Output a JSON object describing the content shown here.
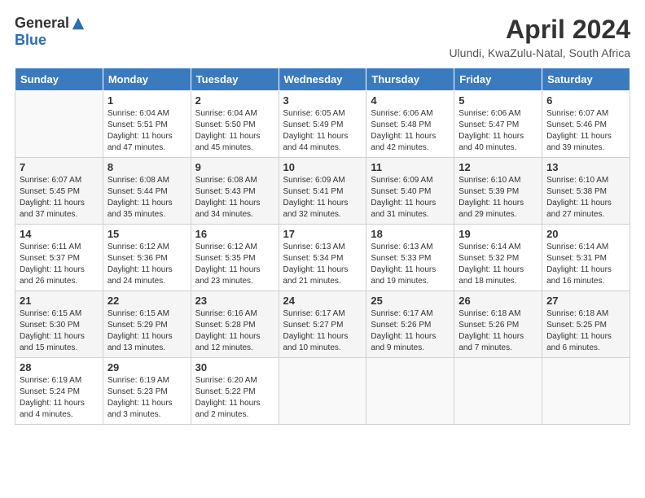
{
  "header": {
    "logo_general": "General",
    "logo_blue": "Blue",
    "main_title": "April 2024",
    "subtitle": "Ulundi, KwaZulu-Natal, South Africa"
  },
  "calendar": {
    "days_of_week": [
      "Sunday",
      "Monday",
      "Tuesday",
      "Wednesday",
      "Thursday",
      "Friday",
      "Saturday"
    ],
    "weeks": [
      [
        {
          "day": "",
          "info": ""
        },
        {
          "day": "1",
          "info": "Sunrise: 6:04 AM\nSunset: 5:51 PM\nDaylight: 11 hours\nand 47 minutes."
        },
        {
          "day": "2",
          "info": "Sunrise: 6:04 AM\nSunset: 5:50 PM\nDaylight: 11 hours\nand 45 minutes."
        },
        {
          "day": "3",
          "info": "Sunrise: 6:05 AM\nSunset: 5:49 PM\nDaylight: 11 hours\nand 44 minutes."
        },
        {
          "day": "4",
          "info": "Sunrise: 6:06 AM\nSunset: 5:48 PM\nDaylight: 11 hours\nand 42 minutes."
        },
        {
          "day": "5",
          "info": "Sunrise: 6:06 AM\nSunset: 5:47 PM\nDaylight: 11 hours\nand 40 minutes."
        },
        {
          "day": "6",
          "info": "Sunrise: 6:07 AM\nSunset: 5:46 PM\nDaylight: 11 hours\nand 39 minutes."
        }
      ],
      [
        {
          "day": "7",
          "info": "Sunrise: 6:07 AM\nSunset: 5:45 PM\nDaylight: 11 hours\nand 37 minutes."
        },
        {
          "day": "8",
          "info": "Sunrise: 6:08 AM\nSunset: 5:44 PM\nDaylight: 11 hours\nand 35 minutes."
        },
        {
          "day": "9",
          "info": "Sunrise: 6:08 AM\nSunset: 5:43 PM\nDaylight: 11 hours\nand 34 minutes."
        },
        {
          "day": "10",
          "info": "Sunrise: 6:09 AM\nSunset: 5:41 PM\nDaylight: 11 hours\nand 32 minutes."
        },
        {
          "day": "11",
          "info": "Sunrise: 6:09 AM\nSunset: 5:40 PM\nDaylight: 11 hours\nand 31 minutes."
        },
        {
          "day": "12",
          "info": "Sunrise: 6:10 AM\nSunset: 5:39 PM\nDaylight: 11 hours\nand 29 minutes."
        },
        {
          "day": "13",
          "info": "Sunrise: 6:10 AM\nSunset: 5:38 PM\nDaylight: 11 hours\nand 27 minutes."
        }
      ],
      [
        {
          "day": "14",
          "info": "Sunrise: 6:11 AM\nSunset: 5:37 PM\nDaylight: 11 hours\nand 26 minutes."
        },
        {
          "day": "15",
          "info": "Sunrise: 6:12 AM\nSunset: 5:36 PM\nDaylight: 11 hours\nand 24 minutes."
        },
        {
          "day": "16",
          "info": "Sunrise: 6:12 AM\nSunset: 5:35 PM\nDaylight: 11 hours\nand 23 minutes."
        },
        {
          "day": "17",
          "info": "Sunrise: 6:13 AM\nSunset: 5:34 PM\nDaylight: 11 hours\nand 21 minutes."
        },
        {
          "day": "18",
          "info": "Sunrise: 6:13 AM\nSunset: 5:33 PM\nDaylight: 11 hours\nand 19 minutes."
        },
        {
          "day": "19",
          "info": "Sunrise: 6:14 AM\nSunset: 5:32 PM\nDaylight: 11 hours\nand 18 minutes."
        },
        {
          "day": "20",
          "info": "Sunrise: 6:14 AM\nSunset: 5:31 PM\nDaylight: 11 hours\nand 16 minutes."
        }
      ],
      [
        {
          "day": "21",
          "info": "Sunrise: 6:15 AM\nSunset: 5:30 PM\nDaylight: 11 hours\nand 15 minutes."
        },
        {
          "day": "22",
          "info": "Sunrise: 6:15 AM\nSunset: 5:29 PM\nDaylight: 11 hours\nand 13 minutes."
        },
        {
          "day": "23",
          "info": "Sunrise: 6:16 AM\nSunset: 5:28 PM\nDaylight: 11 hours\nand 12 minutes."
        },
        {
          "day": "24",
          "info": "Sunrise: 6:17 AM\nSunset: 5:27 PM\nDaylight: 11 hours\nand 10 minutes."
        },
        {
          "day": "25",
          "info": "Sunrise: 6:17 AM\nSunset: 5:26 PM\nDaylight: 11 hours\nand 9 minutes."
        },
        {
          "day": "26",
          "info": "Sunrise: 6:18 AM\nSunset: 5:26 PM\nDaylight: 11 hours\nand 7 minutes."
        },
        {
          "day": "27",
          "info": "Sunrise: 6:18 AM\nSunset: 5:25 PM\nDaylight: 11 hours\nand 6 minutes."
        }
      ],
      [
        {
          "day": "28",
          "info": "Sunrise: 6:19 AM\nSunset: 5:24 PM\nDaylight: 11 hours\nand 4 minutes."
        },
        {
          "day": "29",
          "info": "Sunrise: 6:19 AM\nSunset: 5:23 PM\nDaylight: 11 hours\nand 3 minutes."
        },
        {
          "day": "30",
          "info": "Sunrise: 6:20 AM\nSunset: 5:22 PM\nDaylight: 11 hours\nand 2 minutes."
        },
        {
          "day": "",
          "info": ""
        },
        {
          "day": "",
          "info": ""
        },
        {
          "day": "",
          "info": ""
        },
        {
          "day": "",
          "info": ""
        }
      ]
    ]
  }
}
